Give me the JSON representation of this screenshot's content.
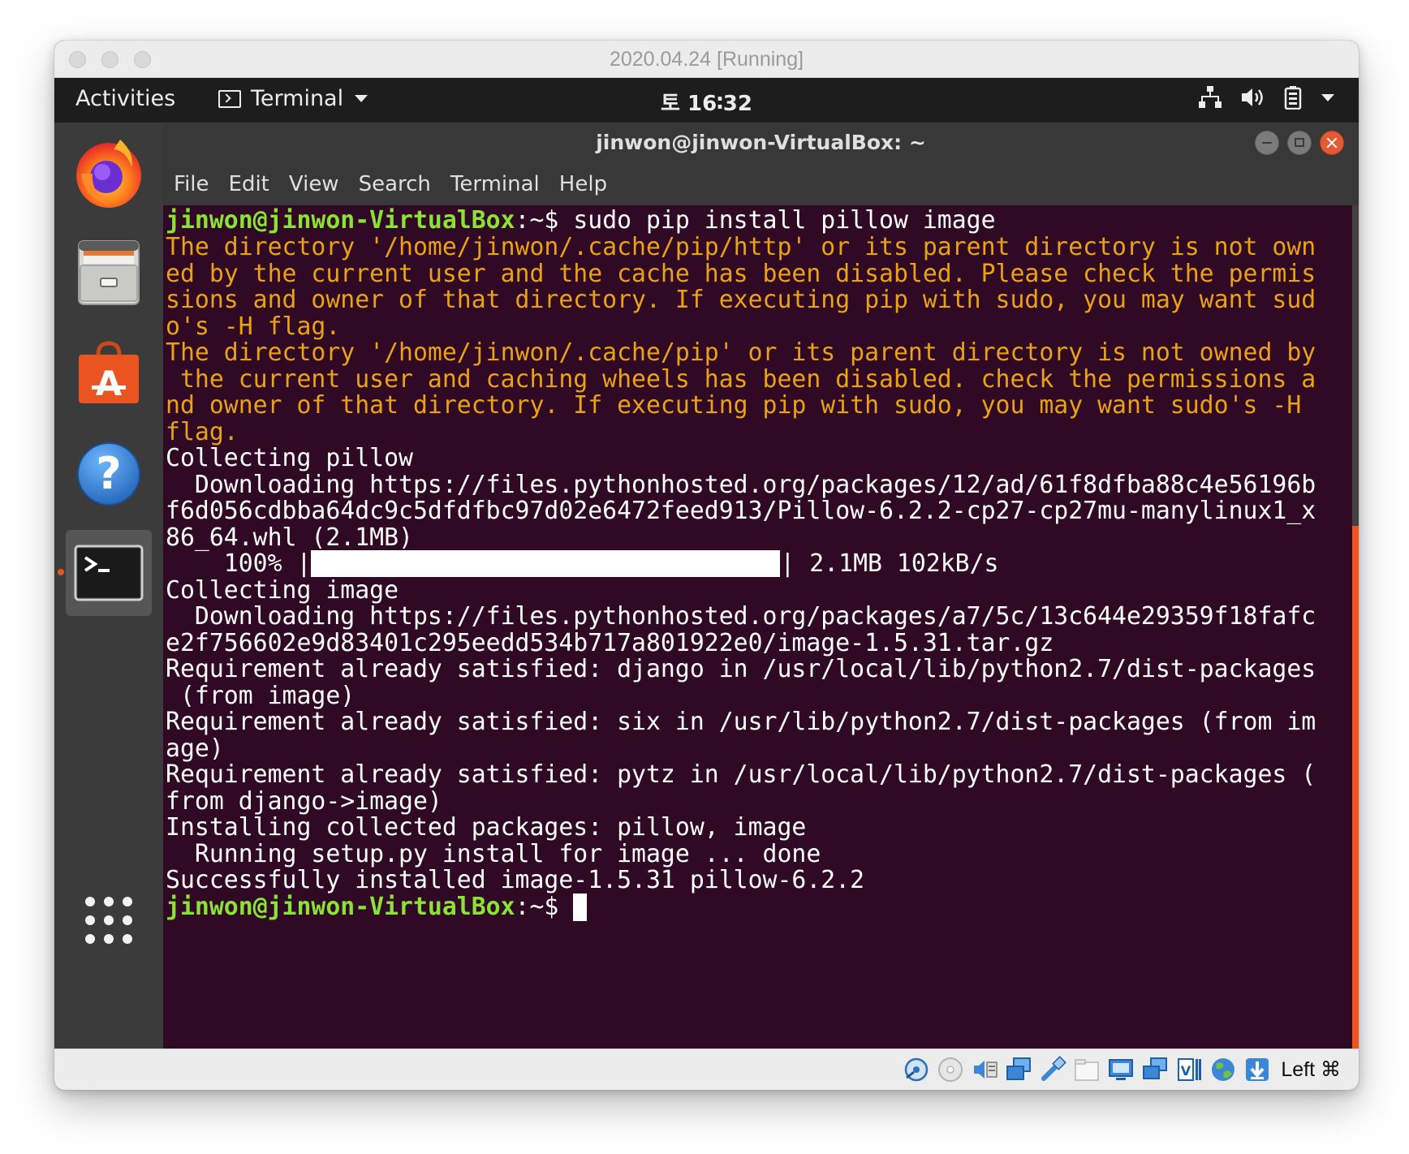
{
  "mac_window": {
    "title": "2020.04.24 [Running]"
  },
  "top_bar": {
    "activities": "Activities",
    "app_menu": "Terminal",
    "clock": "토 16∶32",
    "tray_icons": [
      "network-icon",
      "volume-icon",
      "battery-icon",
      "system-menu-caret-icon"
    ]
  },
  "dock": {
    "items": [
      "firefox-icon",
      "files-icon",
      "software-center-icon",
      "help-icon",
      "terminal-icon"
    ],
    "show_apps": "show-applications-icon"
  },
  "terminal": {
    "title": "jinwon@jinwon-VirtualBox: ~",
    "menu": [
      "File",
      "Edit",
      "View",
      "Search",
      "Terminal",
      "Help"
    ],
    "prompt_user": "jinwon@jinwon-VirtualBox",
    "prompt_path": ":~$",
    "command": " sudo pip install pillow image",
    "lines": [
      "The directory '/home/jinwon/.cache/pip/http' or its parent directory is not own",
      "ed by the current user and the cache has been disabled. Please check the permis",
      "sions and owner of that directory. If executing pip with sudo, you may want sud",
      "o's -H flag.",
      "The directory '/home/jinwon/.cache/pip' or its parent directory is not owned by",
      " the current user and caching wheels has been disabled. check the permissions a",
      "nd owner of that directory. If executing pip with sudo, you may want sudo's -H",
      "flag.",
      "Collecting pillow",
      "  Downloading https://files.pythonhosted.org/packages/12/ad/61f8dfba88c4e56196b",
      "f6d056cdbba64dc9c5dfdfbc97d02e6472feed913/Pillow-6.2.2-cp27-cp27mu-manylinux1_x",
      "86_64.whl (2.1MB)",
      "Collecting image",
      "  Downloading https://files.pythonhosted.org/packages/a7/5c/13c644e29359f18fafc",
      "e2f756602e9d83401c295eedd534b717a801922e0/image-1.5.31.tar.gz",
      "Requirement already satisfied: django in /usr/local/lib/python2.7/dist-packages",
      " (from image)",
      "Requirement already satisfied: six in /usr/lib/python2.7/dist-packages (from im",
      "age)",
      "Requirement already satisfied: pytz in /usr/local/lib/python2.7/dist-packages (",
      "from django->image)",
      "Installing collected packages: pillow, image",
      "  Running setup.py install for image ... done",
      "Successfully installed image-1.5.31 pillow-6.2.2"
    ],
    "progress": {
      "percent_text": "    100% |",
      "end_text": "| 2.1MB 102kB/s",
      "fraction": 1.0
    },
    "scrollbar_position": 0.62
  },
  "vbox_status": {
    "icons": [
      "hard-disk-icon",
      "optical-drive-icon",
      "audio-icon",
      "network-adapters-icon",
      "usb-icon",
      "shared-folders-icon",
      "display-icon",
      "video-capture-icon",
      "virtualization-icon",
      "guest-additions-icon",
      "host-key-arrow-icon"
    ],
    "host_key": "Left ⌘"
  },
  "colors": {
    "terminal_bg": "#300a24",
    "prompt_green": "#8ae234",
    "warning_orange": "#e9a215",
    "ubuntu_orange": "#e95420"
  }
}
